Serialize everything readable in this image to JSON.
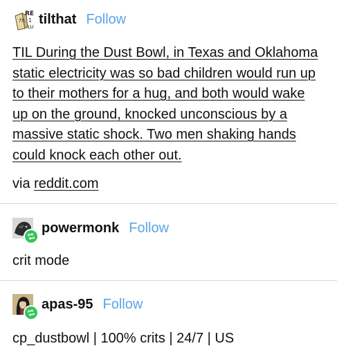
{
  "posts": [
    {
      "username": "tilthat",
      "follow_label": "Follow",
      "avatar_icon": "til-logo-icon",
      "avatar_text": "REI TIL",
      "body_lines": [
        "TIL During the Dust Bowl, in Texas and Oklahoma",
        "static electricity was so bad children would run up",
        "to their mothers for a hug, and both would wake",
        "up on the ground, knocked unconscious by a",
        "massive static shock. Two men shaking hands",
        "could knock each other out."
      ],
      "via_prefix": "via",
      "via_link": "reddit.com"
    },
    {
      "username": "powermonk",
      "follow_label": "Follow",
      "avatar_icon": "dark-creature-avatar-icon",
      "badge_icon": "reblog-icon",
      "body": "crit mode"
    },
    {
      "username": "apas-95",
      "follow_label": "Follow",
      "avatar_icon": "character-portrait-avatar-icon",
      "badge_icon": "reblog-icon",
      "body": "cp_dustbowl | 100% crits | 24/7 | US"
    }
  ],
  "colors": {
    "follow": "#5aa4e8",
    "reblog_badge": "#35c45a",
    "divider": "#d8d8d8",
    "text": "#111111"
  }
}
